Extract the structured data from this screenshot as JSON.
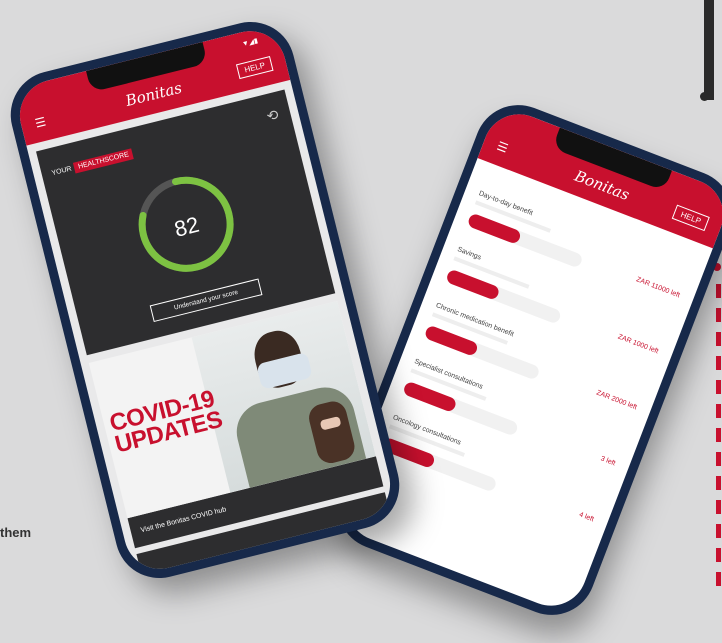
{
  "side_text": "them",
  "left_phone": {
    "app_logo": "Bonitas",
    "help_label": "HELP",
    "healthscore_prefix": "YOUR",
    "healthscore_label": "HEALTHSCORE",
    "score": "82",
    "score_fraction": 0.82,
    "understand_button": "Understand your score",
    "covid_title_line1": "COVID-19",
    "covid_title_line2": "UPDATES",
    "visit_link": "Visit the Bonitas COVID hub"
  },
  "right_phone": {
    "app_logo": "Bonitas",
    "help_label": "HELP",
    "benefits": [
      {
        "name": "Day-to-day benefit",
        "amount": "ZAR 11000 left",
        "fraction": 0.45
      },
      {
        "name": "Savings",
        "amount": "ZAR 1000 left",
        "fraction": 0.45
      },
      {
        "name": "Chronic medication benefit",
        "amount": "ZAR 2000 left",
        "fraction": 0.45
      },
      {
        "name": "Specialist consultations",
        "amount": "3 left",
        "fraction": 0.45
      },
      {
        "name": "Oncology consultations",
        "amount": "4 left",
        "fraction": 0.45
      }
    ]
  },
  "colors": {
    "brand_red": "#c8102e",
    "gauge_green": "#7dc242",
    "dark_card": "#2d2d2f"
  }
}
